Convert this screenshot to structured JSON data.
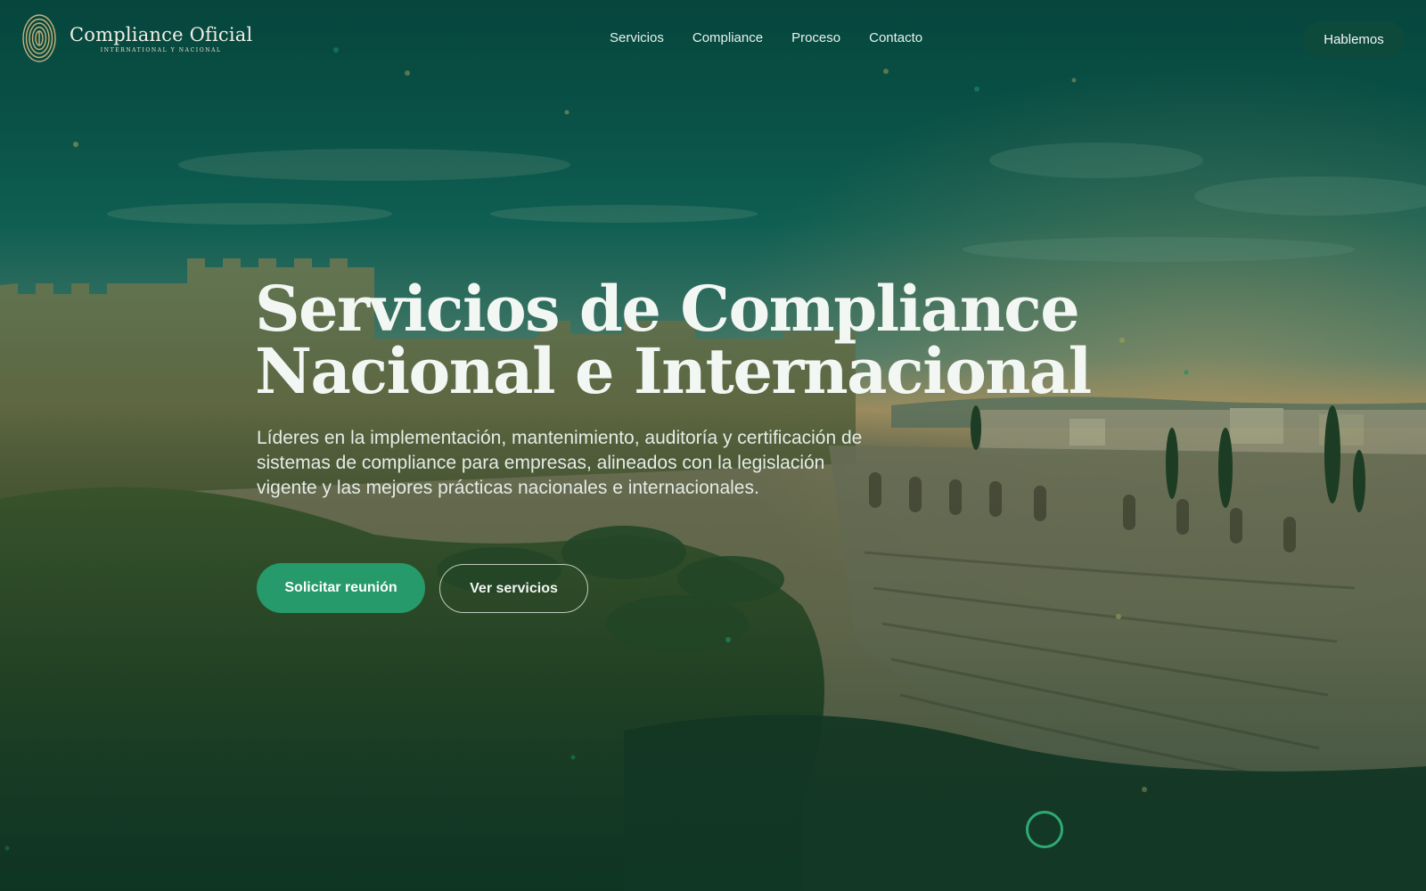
{
  "brand": {
    "name": "Compliance Oficial",
    "tagline": "INTERNATIONAL Y NACIONAL"
  },
  "nav": {
    "items": [
      {
        "label": "Servicios"
      },
      {
        "label": "Compliance"
      },
      {
        "label": "Proceso"
      },
      {
        "label": "Contacto"
      }
    ]
  },
  "header": {
    "cta_label": "Hablemos"
  },
  "hero": {
    "title_line1": "Servicios de Compliance",
    "title_line2": "Nacional e Internacional",
    "subtitle": "Líderes en la implementación, mantenimiento, auditoría y certificación de sistemas de compliance para empresas, alineados con la legislación vigente y las mejores prácticas nacionales e internacionales.",
    "primary_button": "Solicitar reunión",
    "secondary_button": "Ver servicios"
  },
  "icons": {
    "logo": "fingerprint-icon",
    "scroll": "scroll-indicator-icon"
  },
  "colors": {
    "accent": "#269a6a",
    "header_button_bg": "#0e4a3c",
    "title_text": "#f2f7f3",
    "logo_gold": "#c9b27a"
  }
}
